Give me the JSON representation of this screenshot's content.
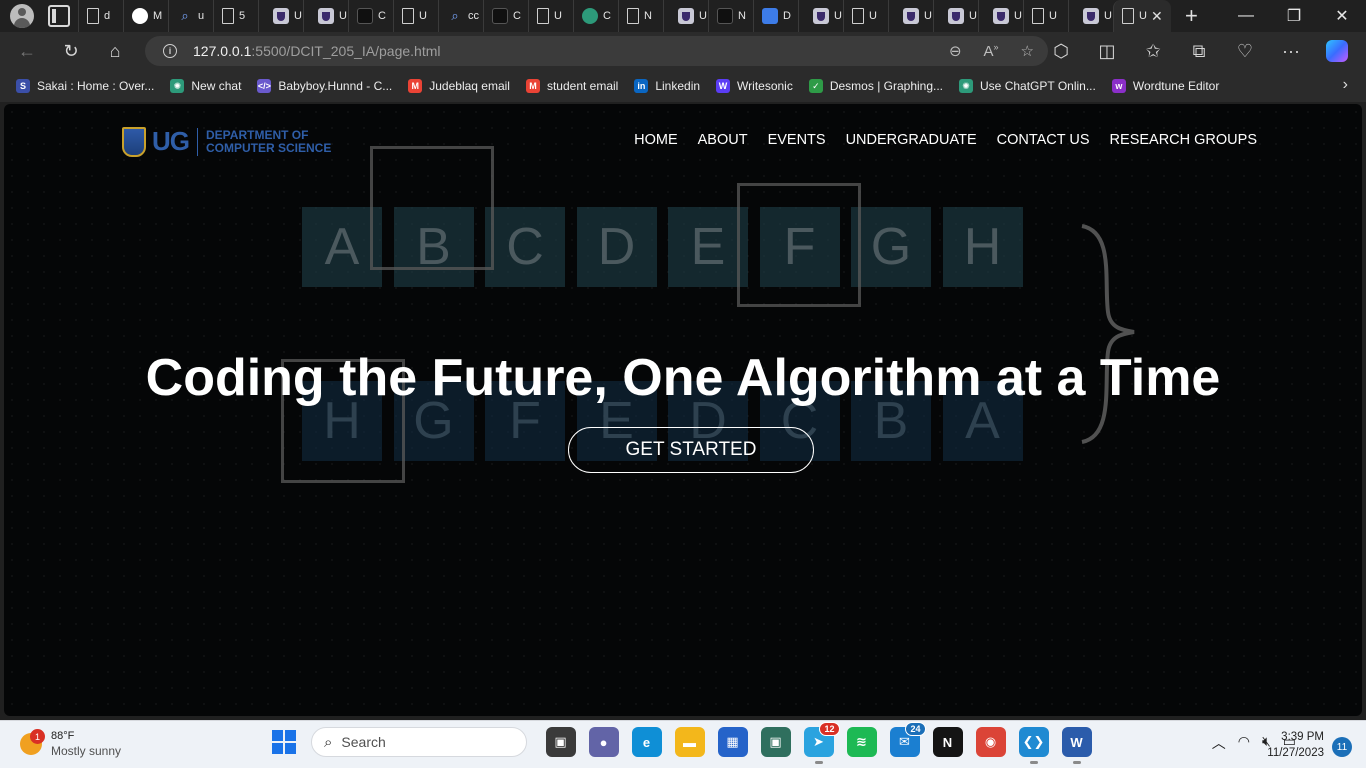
{
  "browser": {
    "tabs": [
      {
        "label": "d",
        "icon": "doc-icon"
      },
      {
        "label": "M",
        "icon": "github-icon"
      },
      {
        "label": "u",
        "icon": "search-icon"
      },
      {
        "label": "5",
        "icon": "doc-icon"
      },
      {
        "label": "U",
        "icon": "ug-crest-icon"
      },
      {
        "label": "U",
        "icon": "ug-crest-icon"
      },
      {
        "label": "C",
        "icon": "dark-app-icon"
      },
      {
        "label": "U",
        "icon": "doc-icon"
      },
      {
        "label": "cc",
        "icon": "search-icon"
      },
      {
        "label": "C",
        "icon": "dark-app-icon"
      },
      {
        "label": "U",
        "icon": "doc-icon"
      },
      {
        "label": "C",
        "icon": "chatgpt-icon"
      },
      {
        "label": "N",
        "icon": "doc-icon"
      },
      {
        "label": "U",
        "icon": "ug-crest-icon"
      },
      {
        "label": "N",
        "icon": "calendar-icon"
      },
      {
        "label": "D",
        "icon": "google-docs-icon"
      },
      {
        "label": "U",
        "icon": "ug-crest-icon"
      },
      {
        "label": "U",
        "icon": "doc-icon"
      },
      {
        "label": "U",
        "icon": "ug-crest-icon"
      },
      {
        "label": "U",
        "icon": "ug-crest-icon"
      },
      {
        "label": "U",
        "icon": "ug-crest-icon"
      },
      {
        "label": "U",
        "icon": "doc-icon"
      },
      {
        "label": "U",
        "icon": "ug-crest-icon"
      },
      {
        "label": "U",
        "icon": "page-icon"
      }
    ],
    "url_host": "127.0.0.1",
    "url_rest": ":5500/DCIT_205_IA/page.html",
    "bookmarks": [
      {
        "label": "Sakai : Home : Over...",
        "color": "#3b4fa8",
        "glyph": "S"
      },
      {
        "label": "New chat",
        "color": "#2d9a7a",
        "glyph": "✺"
      },
      {
        "label": "Babyboy.Hunnd - C...",
        "color": "#6a5acd",
        "glyph": "</>"
      },
      {
        "label": "Judeblaq email",
        "color": "#ea4335",
        "glyph": "M"
      },
      {
        "label": "student email",
        "color": "#ea4335",
        "glyph": "M"
      },
      {
        "label": "Linkedin",
        "color": "#0a66c2",
        "glyph": "in"
      },
      {
        "label": "Writesonic",
        "color": "#5b3df5",
        "glyph": "W"
      },
      {
        "label": "Desmos | Graphing...",
        "color": "#2e9b47",
        "glyph": "✓"
      },
      {
        "label": "Use ChatGPT Onlin...",
        "color": "#2d9a7a",
        "glyph": "✺"
      },
      {
        "label": "Wordtune Editor",
        "color": "#8b2fc9",
        "glyph": "w"
      }
    ]
  },
  "site": {
    "logo_mark": "UG",
    "logo_line1": "DEPARTMENT OF",
    "logo_line2": "COMPUTER SCIENCE",
    "nav": [
      "HOME",
      "ABOUT",
      "EVENTS",
      "UNDERGRADUATE",
      "CONTACT US",
      "RESEARCH GROUPS"
    ],
    "headline": "Coding the Future, One Algorithm at a Time",
    "cta": "GET STARTED",
    "bg_letters_top": [
      "A",
      "B",
      "C",
      "D",
      "E",
      "F",
      "G",
      "H"
    ],
    "bg_letters_bottom": [
      "H",
      "G",
      "F",
      "E",
      "D",
      "C",
      "B",
      "A"
    ]
  },
  "taskbar": {
    "weather_temp": "88°F",
    "weather_cond": "Mostly sunny",
    "weather_badge": "1",
    "search_placeholder": "Search",
    "apps": [
      {
        "name": "task-view-icon",
        "color": "#3a3a3a",
        "glyph": "▣",
        "state": ""
      },
      {
        "name": "teams-chat-icon",
        "color": "#6264a7",
        "glyph": "●",
        "state": ""
      },
      {
        "name": "edge-icon",
        "color": "#0f8fd6",
        "glyph": "e",
        "state": "active"
      },
      {
        "name": "file-explorer-icon",
        "color": "#f3b71b",
        "glyph": "▬",
        "state": ""
      },
      {
        "name": "store-icon",
        "color": "#2563c9",
        "glyph": "▦",
        "state": ""
      },
      {
        "name": "photos-icon",
        "color": "#2f6f5e",
        "glyph": "▣",
        "state": ""
      },
      {
        "name": "telegram-icon",
        "color": "#2aa3df",
        "glyph": "➤",
        "state": "running",
        "badge": "12",
        "badge_red": true
      },
      {
        "name": "spotify-icon",
        "color": "#1db954",
        "glyph": "≋",
        "state": ""
      },
      {
        "name": "mail-icon",
        "color": "#1b7fd1",
        "glyph": "✉",
        "state": "",
        "badge": "24"
      },
      {
        "name": "netflix-icon",
        "color": "#141414",
        "glyph": "N",
        "state": ""
      },
      {
        "name": "chrome-icon",
        "color": "#db4437",
        "glyph": "◉",
        "state": ""
      },
      {
        "name": "vscode-icon",
        "color": "#1f8ad2",
        "glyph": "❮❯",
        "state": "running"
      },
      {
        "name": "word-icon",
        "color": "#2b5cab",
        "glyph": "W",
        "state": "running"
      }
    ],
    "time": "3:39 PM",
    "date": "11/27/2023",
    "notifications": "11"
  }
}
